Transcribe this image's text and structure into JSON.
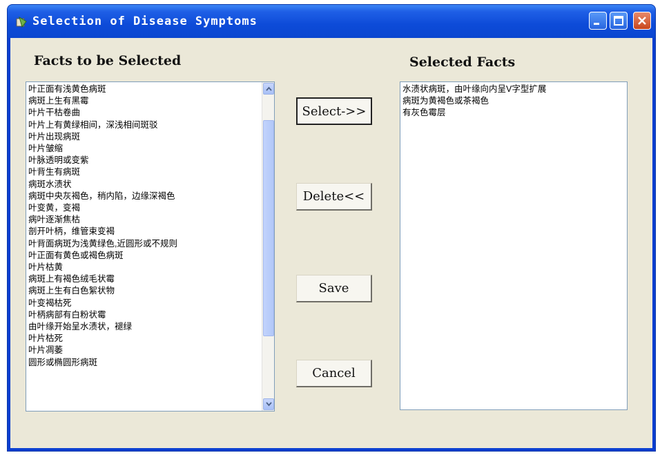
{
  "window": {
    "title": "Selection of Disease Symptoms",
    "buttons": [
      "minimize-icon",
      "maximize-icon",
      "close-icon"
    ]
  },
  "left_panel": {
    "label": "Facts to be Selected",
    "items": [
      "叶正面有浅黄色病斑",
      "病斑上生有黑霉",
      "叶片干枯卷曲",
      "叶片上有黄绿相间，深浅相间斑驳",
      "叶片出现病斑",
      "叶片皱缩",
      "叶脉透明或变紫",
      "叶背生有病斑",
      "病斑水渍状",
      "病斑中央灰褐色，稍内陷，边缘深褐色",
      "叶变黄，变褐",
      "病叶逐渐焦枯",
      "剖开叶柄，维管束变褐",
      "叶背面病斑为浅黄绿色,近圆形或不规则",
      "叶正面有黄色或褐色病斑",
      "叶片枯黄",
      "病斑上有褐色绒毛状霉",
      "病斑上生有白色絮状物",
      "叶变褐枯死",
      "叶柄病部有白粉状霉",
      "由叶缘开始呈水渍状，褪绿",
      "叶片枯死",
      "叶片凋萎",
      "圆形或椭圆形病斑"
    ]
  },
  "right_panel": {
    "label": "Selected Facts",
    "items": [
      "水渍状病斑，由叶缘向内呈V字型扩展",
      "病斑为黄褐色或茶褐色",
      "有灰色霉层"
    ]
  },
  "actions": {
    "select_label": "Select->>",
    "delete_label": "Delete<<",
    "save_label": "Save",
    "cancel_label": "Cancel"
  },
  "colors": {
    "titlebar": "#0b46d0",
    "client_bg": "#ebe8d8",
    "close_button": "#c9461c"
  }
}
